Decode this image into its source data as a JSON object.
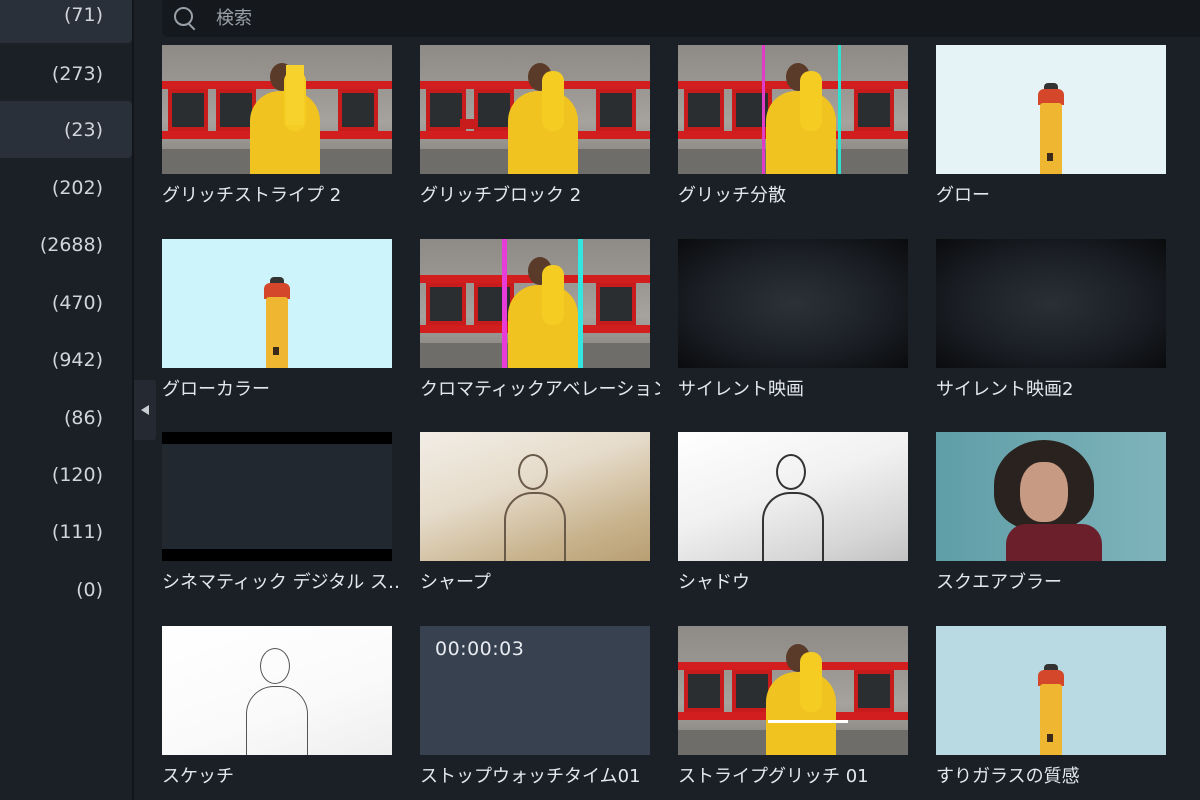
{
  "sidebar": {
    "categories": [
      {
        "count": "(71)",
        "selected": true
      },
      {
        "count": "(273)",
        "selected": false
      },
      {
        "count": "(23)",
        "selected": true
      },
      {
        "count": "(202)",
        "selected": false
      },
      {
        "count": "(2688)",
        "selected": false
      },
      {
        "count": "(470)",
        "selected": false
      },
      {
        "count": "(942)",
        "selected": false
      },
      {
        "count": "(86)",
        "selected": false
      },
      {
        "count": "(120)",
        "selected": false
      },
      {
        "count": "(111)",
        "selected": false
      },
      {
        "count": "(0)",
        "selected": false
      }
    ]
  },
  "search": {
    "placeholder": "検索",
    "icon": "search-icon"
  },
  "collapse_icon": "chevron-left-icon",
  "effects": [
    {
      "label": "グリッチストライプ 2",
      "thumb": "wall-glitch"
    },
    {
      "label": "グリッチブロック 2",
      "thumb": "wall-glitch"
    },
    {
      "label": "グリッチ分散",
      "thumb": "wall-glitch"
    },
    {
      "label": "グロー",
      "thumb": "lighthouse"
    },
    {
      "label": "グローカラー",
      "thumb": "lighthouse-cyan"
    },
    {
      "label": "クロマティックアベレーション",
      "thumb": "wall-chromatic"
    },
    {
      "label": "サイレント映画",
      "thumb": "dark-vignette"
    },
    {
      "label": "サイレント映画2",
      "thumb": "dark-vignette-dust"
    },
    {
      "label": "シネマティック デジタル ス…",
      "thumb": "letterbox"
    },
    {
      "label": "シャープ",
      "thumb": "sharpened-portrait"
    },
    {
      "label": "シャドウ",
      "thumb": "shadow-portrait"
    },
    {
      "label": "スクエアブラー",
      "thumb": "blur-portrait"
    },
    {
      "label": "スケッチ",
      "thumb": "sketch-portrait"
    },
    {
      "label": "ストップウォッチタイム01",
      "thumb": "stopwatch",
      "timecode": "00:00:03"
    },
    {
      "label": "ストライプグリッチ 01",
      "thumb": "wall-glitch"
    },
    {
      "label": "すりガラスの質感",
      "thumb": "lighthouse-frosted"
    }
  ]
}
